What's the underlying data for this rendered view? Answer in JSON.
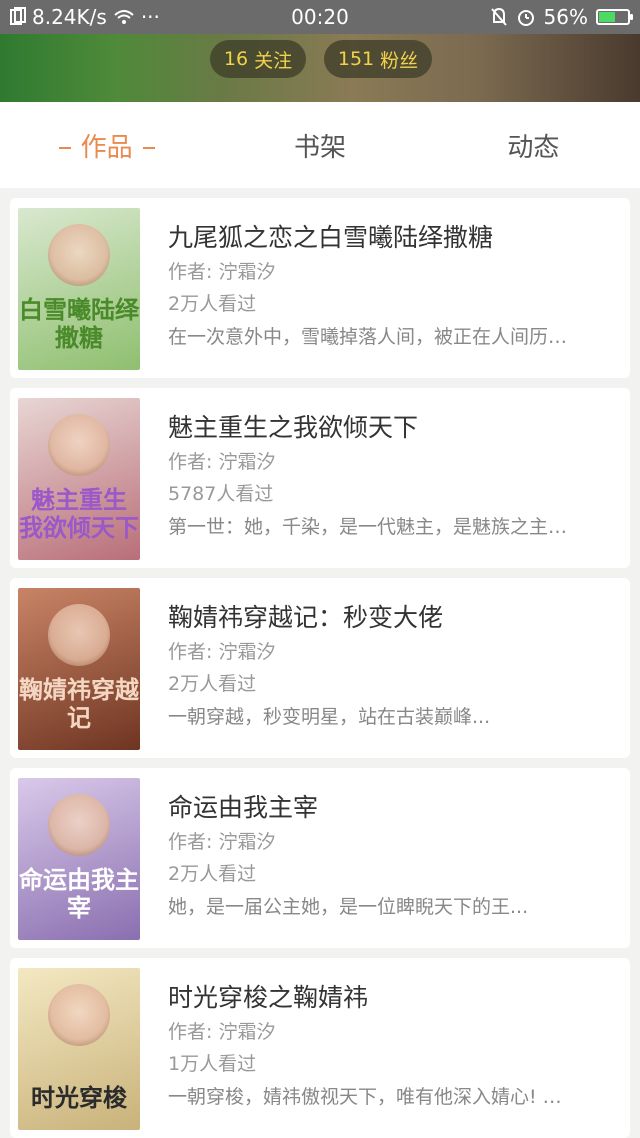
{
  "status_bar": {
    "net_speed": "8.24K/s",
    "dots": "···",
    "time": "00:20",
    "battery": "56%",
    "battery_level": 0.56
  },
  "profile": {
    "follow_count": "16",
    "follow_label": "关注",
    "fans_count": "151",
    "fans_label": "粉丝"
  },
  "tabs": [
    {
      "label": "作品",
      "active": true
    },
    {
      "label": "书架",
      "active": false
    },
    {
      "label": "动态",
      "active": false
    }
  ],
  "books": [
    {
      "title": "九尾狐之恋之白雪曦陆绎撒糖",
      "author": "作者: 泞霜汐",
      "views": "2万人看过",
      "desc": "在一次意外中，雪曦掉落人间，被正在人间历…",
      "cover_text": "白雪曦陆绎撒糖",
      "cover_colors": [
        "#d9e8cf",
        "#8fbf6f"
      ],
      "cover_text_color": "#4a8a2a"
    },
    {
      "title": "魅主重生之我欲倾天下",
      "author": "作者: 泞霜汐",
      "views": "5787人看过",
      "desc": "第一世：她，千染，是一代魅主，是魅族之主…",
      "cover_text": "魅主重生 我欲倾天下",
      "cover_colors": [
        "#e8d6d4",
        "#b96e78"
      ],
      "cover_text_color": "#9a58c9"
    },
    {
      "title": "鞠婧祎穿越记：秒变大佬",
      "author": "作者: 泞霜汐",
      "views": "2万人看过",
      "desc": "一朝穿越，秒变明星，站在古装巅峰...",
      "cover_text": "鞠婧祎穿越记",
      "cover_colors": [
        "#c98466",
        "#6f3522"
      ],
      "cover_text_color": "#f4d7c2"
    },
    {
      "title": "命运由我主宰",
      "author": "作者: 泞霜汐",
      "views": "2万人看过",
      "desc": "她，是一届公主她，是一位睥睨天下的王...",
      "cover_text": "命运由我主宰",
      "cover_colors": [
        "#d9c9e9",
        "#8a6fb0"
      ],
      "cover_text_color": "#ffffff"
    },
    {
      "title": "时光穿梭之鞠婧祎",
      "author": "作者: 泞霜汐",
      "views": "1万人看过",
      "desc": "一朝穿梭，婧祎傲视天下，唯有他深入婧心! …",
      "cover_text": "时光穿梭",
      "cover_colors": [
        "#f3e8c2",
        "#c9b27a"
      ],
      "cover_text_color": "#2b2b2b"
    }
  ]
}
